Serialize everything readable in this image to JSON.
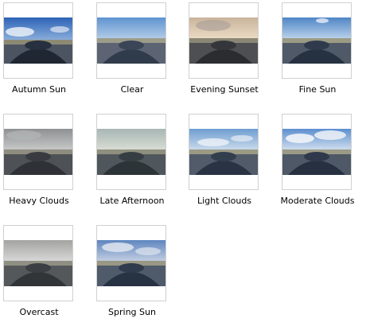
{
  "gallery": {
    "items": [
      {
        "label": "Autumn Sun"
      },
      {
        "label": "Clear"
      },
      {
        "label": "Evening Sunset"
      },
      {
        "label": "Fine Sun"
      },
      {
        "label": "Heavy Clouds"
      },
      {
        "label": "Late Afternoon"
      },
      {
        "label": "Light Clouds"
      },
      {
        "label": "Moderate Clouds"
      },
      {
        "label": "Overcast"
      },
      {
        "label": "Spring Sun"
      }
    ]
  },
  "thumbnails": {
    "icon": "car-hood-road-preview-image",
    "sky_colors": {
      "autumn_sun": [
        "#2d63b6",
        "#8fb2dc"
      ],
      "clear": [
        "#5e93cf",
        "#bcd3eb"
      ],
      "evening_sunset": [
        "#c9b39b",
        "#efe0c8"
      ],
      "fine_sun": [
        "#4f86c6",
        "#c7dbef"
      ],
      "heavy_clouds": [
        "#8e9092",
        "#cfd0cf"
      ],
      "late_afternoon": [
        "#a8b6b4",
        "#dfe2d8"
      ],
      "light_clouds": [
        "#6e9dd0",
        "#d6e3ef"
      ],
      "moderate_clouds": [
        "#5b8fcf",
        "#dfe8f2"
      ],
      "overcast": [
        "#a3a4a2",
        "#dedede"
      ],
      "spring_sun": [
        "#5f86bf",
        "#cfd8e6"
      ]
    }
  }
}
